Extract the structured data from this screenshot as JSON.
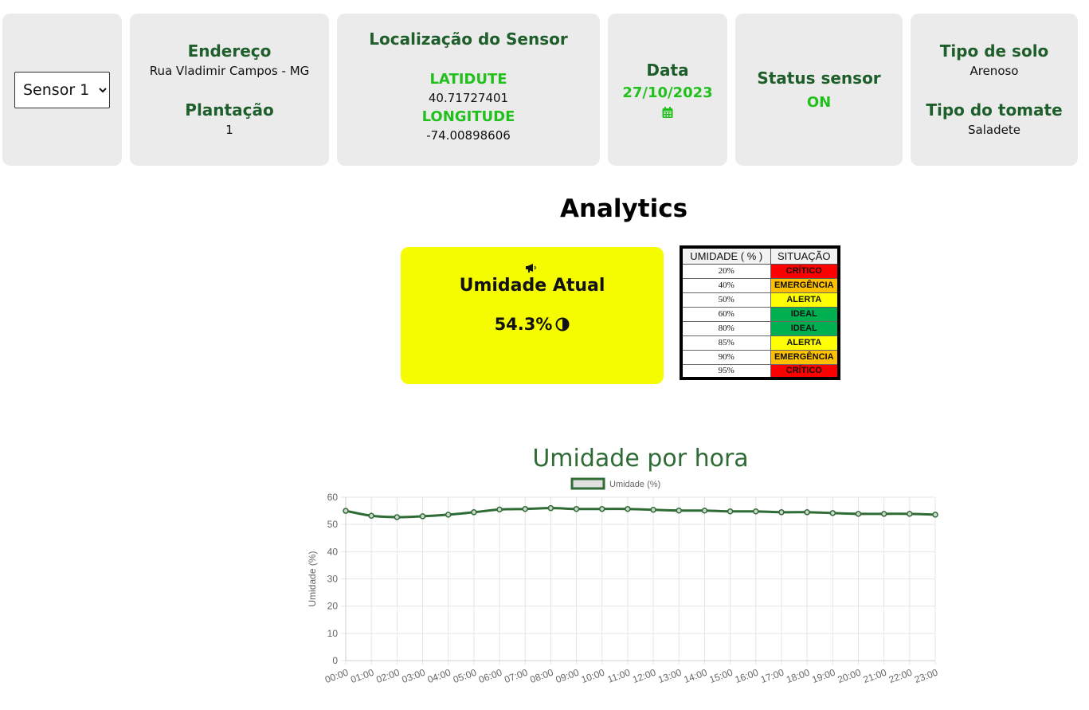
{
  "sensor_select": {
    "options": [
      "Sensor 1"
    ],
    "selected": "Sensor 1"
  },
  "endereco": {
    "label": "Endereço",
    "value": "Rua Vladimir Campos - MG"
  },
  "plantacao": {
    "label": "Plantação",
    "value": "1"
  },
  "localizacao": {
    "label": "Localização do Sensor",
    "lat_label": "LATIDUTE",
    "lat_value": "40.71727401",
    "lon_label": "LONGITUDE",
    "lon_value": "-74.00898606"
  },
  "data": {
    "label": "Data",
    "value": "27/10/2023",
    "icon": "calendar-icon"
  },
  "status": {
    "label": "Status sensor",
    "value": "ON"
  },
  "solo": {
    "label": "Tipo de solo",
    "value": "Arenoso"
  },
  "tomate": {
    "label": "Tipo do tomate",
    "value": "Saladete"
  },
  "analytics": {
    "title": "Analytics"
  },
  "umidade_atual": {
    "icon": "megaphone-icon",
    "label": "Umidade Atual",
    "value": "54.3%",
    "value_icon": "half-circle-icon",
    "bg_color": "#f5fb00"
  },
  "ref_table": {
    "headers": [
      "UMIDADE ( % )",
      "SITUAÇÃO"
    ],
    "rows": [
      {
        "pct": "20%",
        "sit": "CRÍTICO",
        "color": "#ff0000"
      },
      {
        "pct": "40%",
        "sit": "EMERGÊNCIA",
        "color": "#ffc000"
      },
      {
        "pct": "50%",
        "sit": "ALERTA",
        "color": "#ffff00"
      },
      {
        "pct": "60%",
        "sit": "IDEAL",
        "color": "#00b050"
      },
      {
        "pct": "80%",
        "sit": "IDEAL",
        "color": "#00b050"
      },
      {
        "pct": "85%",
        "sit": "ALERTA",
        "color": "#ffff00"
      },
      {
        "pct": "90%",
        "sit": "EMERGÊNCIA",
        "color": "#ffc000"
      },
      {
        "pct": "95%",
        "sit": "CRÍTICO",
        "color": "#ff0000"
      }
    ]
  },
  "chart_data": {
    "type": "line",
    "title": "Umidade por hora",
    "ylabel": "Umidade (%)",
    "xlabel": "",
    "legend_position": "top",
    "grid": true,
    "ylim": [
      0,
      60
    ],
    "yticks": [
      0,
      10,
      20,
      30,
      40,
      50,
      60
    ],
    "x": [
      "00:00",
      "01:00",
      "02:00",
      "03:00",
      "04:00",
      "05:00",
      "06:00",
      "07:00",
      "08:00",
      "09:00",
      "10:00",
      "11:00",
      "12:00",
      "13:00",
      "14:00",
      "15:00",
      "16:00",
      "17:00",
      "18:00",
      "19:00",
      "20:00",
      "21:00",
      "22:00",
      "23:00"
    ],
    "series": [
      {
        "name": "Umidade (%)",
        "color": "#2e6b35",
        "values": [
          55.0,
          53.2,
          52.7,
          53.0,
          53.6,
          54.5,
          55.5,
          55.7,
          56.0,
          55.7,
          55.7,
          55.7,
          55.4,
          55.1,
          55.1,
          54.8,
          54.8,
          54.5,
          54.5,
          54.2,
          53.9,
          53.9,
          53.9,
          53.6
        ]
      }
    ],
    "title_color": "#2e6b35"
  }
}
